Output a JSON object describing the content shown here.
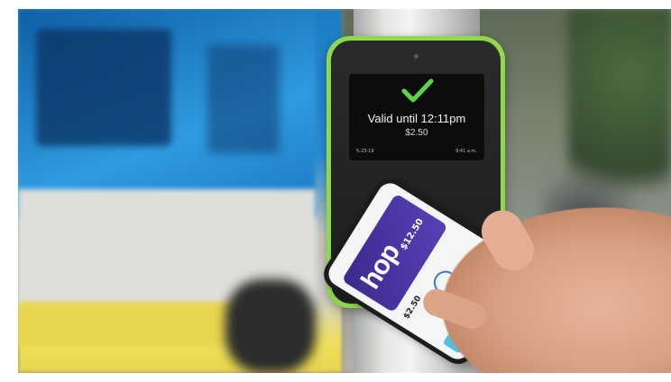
{
  "reader": {
    "status": "Valid until 12:11pm",
    "fare": "$2.50",
    "date": "5-23-19",
    "time": "9:41 a.m."
  },
  "phone": {
    "logo": "hop",
    "balance": "$12.50",
    "charged": "$2.50"
  },
  "colors": {
    "reader_frame": "#8ed84a",
    "check": "#5fd34a",
    "hop_card": "#4a34a4"
  }
}
